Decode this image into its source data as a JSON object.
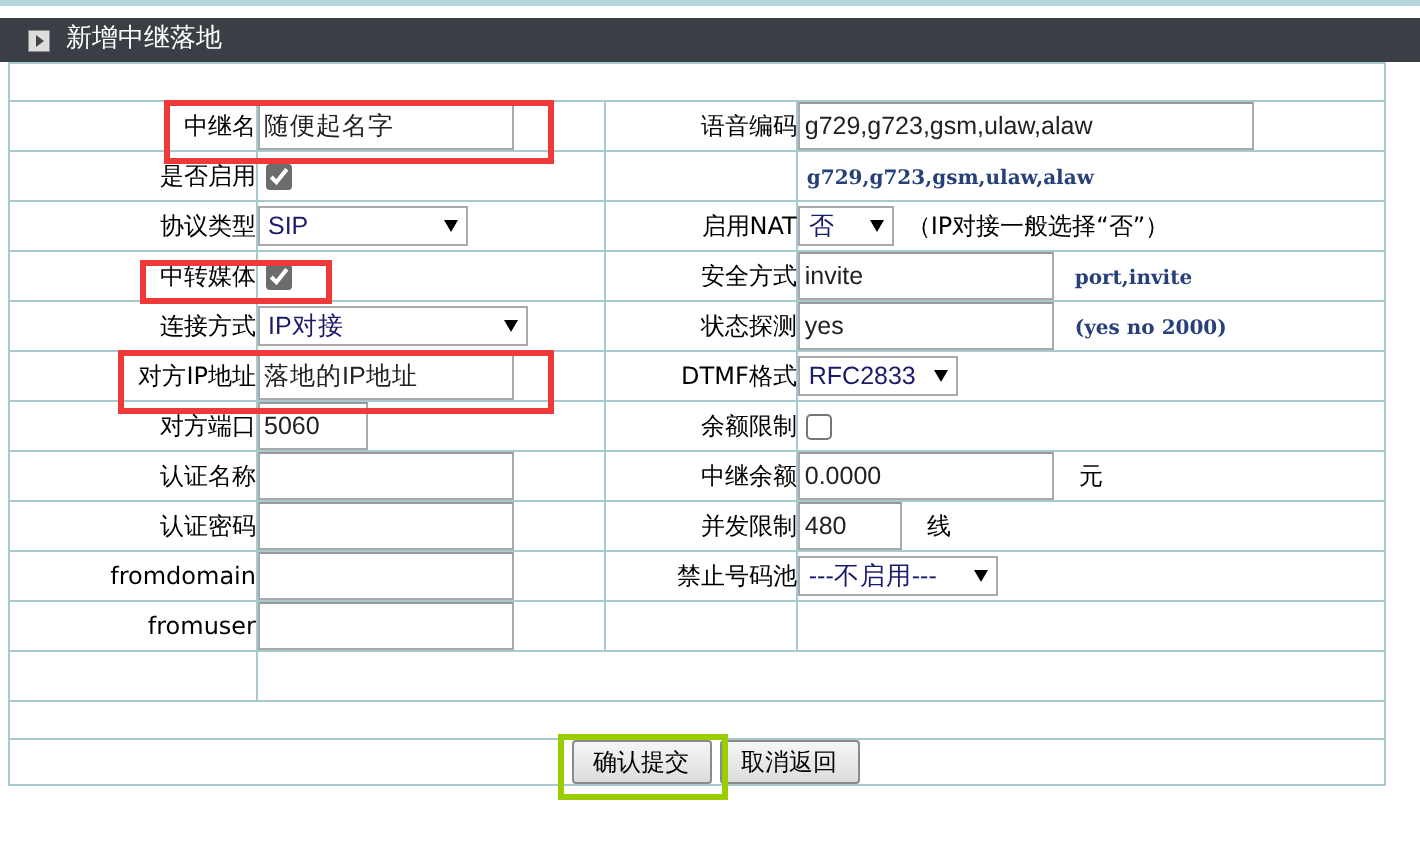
{
  "window": {
    "title": "新增中继落地"
  },
  "left_fields": [
    {
      "label": "中继名",
      "kind": "text",
      "value": "随便起名字",
      "highlighted": true
    },
    {
      "label": "是否启用",
      "kind": "checkbox",
      "checked": true,
      "highlighted": false
    },
    {
      "label": "协议类型",
      "kind": "select",
      "value": "SIP",
      "highlighted": false
    },
    {
      "label": "中转媒体",
      "kind": "checkbox",
      "checked": true,
      "highlighted": true
    },
    {
      "label": "连接方式",
      "kind": "select",
      "value": "IP对接",
      "highlighted": false
    },
    {
      "label": "对方IP地址",
      "kind": "text",
      "value": "落地的IP地址",
      "highlighted": true
    },
    {
      "label": "对方端口",
      "kind": "text",
      "value": "5060",
      "highlighted": false
    },
    {
      "label": "认证名称",
      "kind": "text",
      "highlighted": false
    },
    {
      "label": "认证密码",
      "kind": "text",
      "highlighted": false
    },
    {
      "label": "fromdomain",
      "kind": "text",
      "highlighted": false
    },
    {
      "label": "fromuser",
      "kind": "text",
      "highlighted": false
    }
  ],
  "right_fields": [
    {
      "label": "语音编码",
      "kind": "text",
      "value": "g729,g723,gsm,ulaw,alaw"
    },
    {
      "kind": "hint",
      "text": "g729,g723,gsm,ulaw,alaw"
    },
    {
      "label": "启用NAT",
      "kind": "select",
      "value": "否",
      "note": "（IP对接一般选择“否”）"
    },
    {
      "label": "安全方式",
      "kind": "text",
      "value": "invite",
      "hint": "port,invite"
    },
    {
      "label": "状态探测",
      "kind": "text",
      "value": "yes",
      "hint": "(yes no 2000)"
    },
    {
      "label": "DTMF格式",
      "kind": "select",
      "value": "RFC2833"
    },
    {
      "label": "余额限制",
      "kind": "checkbox",
      "checked": false
    },
    {
      "label": "中继余额",
      "kind": "text",
      "value": "0.0000",
      "note": "元"
    },
    {
      "label": "并发限制",
      "kind": "text",
      "value": "480",
      "note": "线"
    },
    {
      "label": "禁止号码池",
      "kind": "select",
      "value": "---不启用---"
    }
  ],
  "buttons": [
    {
      "label": "确认提交",
      "highlighted": true
    },
    {
      "label": "取消返回",
      "highlighted": false
    }
  ]
}
